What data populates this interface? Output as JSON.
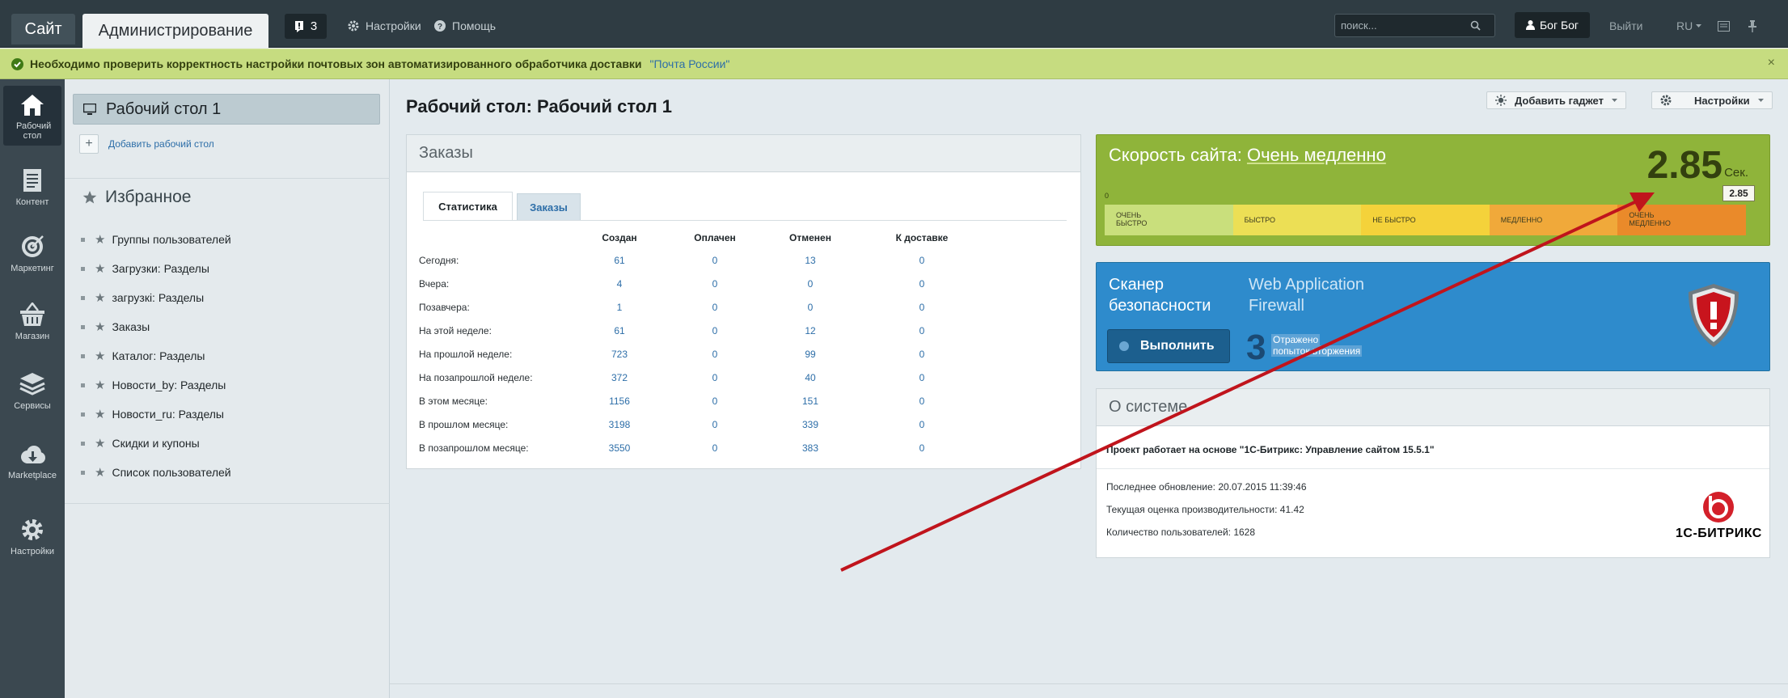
{
  "topbar": {
    "site_label": "Сайт",
    "admin_label": "Администрирование",
    "notif_count": "3",
    "settings_label": "Настройки",
    "help_label": "Помощь",
    "search_placeholder": "поиск...",
    "user_name": "Бог Бог",
    "logout_label": "Выйти",
    "lang_label": "RU"
  },
  "warning": {
    "text": "Необходимо проверить корректность настройки почтовых зон автоматизированного обработчика доставки",
    "link": "\"Почта России\"",
    "close": "×"
  },
  "leftmenu": [
    {
      "label": "Рабочий стол",
      "icon": "home-icon",
      "active": true
    },
    {
      "label": "Контент",
      "icon": "content-icon"
    },
    {
      "label": "Маркетинг",
      "icon": "target-icon"
    },
    {
      "label": "Магазин",
      "icon": "basket-icon"
    },
    {
      "label": "Сервисы",
      "icon": "layers-icon"
    },
    {
      "label": "Marketplace",
      "icon": "cloud-icon"
    },
    {
      "label": "Настройки",
      "icon": "gear-icon"
    }
  ],
  "sidebar": {
    "active_desktop": "Рабочий стол 1",
    "add_desktop": "Добавить рабочий стол",
    "favorites_title": "Избранное",
    "favorites": [
      "Группы пользователей",
      "Загрузки: Разделы",
      "загрузкі: Разделы",
      "Заказы",
      "Каталог: Разделы",
      "Новости_by: Разделы",
      "Новости_ru: Разделы",
      "Скидки и купоны",
      "Список пользователей"
    ]
  },
  "main": {
    "title": "Рабочий стол: Рабочий стол 1",
    "add_gadget": "Добавить гаджет",
    "settings": "Настройки"
  },
  "orders": {
    "title": "Заказы",
    "tabs": [
      "Статистика",
      "Заказы"
    ],
    "columns": [
      "Создан",
      "Оплачен",
      "Отменен",
      "К доставке"
    ],
    "rows": [
      {
        "label": "Сегодня:",
        "values": [
          "61",
          "0",
          "13",
          "0"
        ]
      },
      {
        "label": "Вчера:",
        "values": [
          "4",
          "0",
          "0",
          "0"
        ]
      },
      {
        "label": "Позавчера:",
        "values": [
          "1",
          "0",
          "0",
          "0"
        ]
      },
      {
        "label": "На этой неделе:",
        "values": [
          "61",
          "0",
          "12",
          "0"
        ]
      },
      {
        "label": "На прошлой неделе:",
        "values": [
          "723",
          "0",
          "99",
          "0"
        ]
      },
      {
        "label": "На позапрошлой неделе:",
        "values": [
          "372",
          "0",
          "40",
          "0"
        ]
      },
      {
        "label": "В этом месяце:",
        "values": [
          "1156",
          "0",
          "151",
          "0"
        ]
      },
      {
        "label": "В прошлом месяце:",
        "values": [
          "3198",
          "0",
          "339",
          "0"
        ]
      },
      {
        "label": "В позапрошлом месяце:",
        "values": [
          "3550",
          "0",
          "383",
          "0"
        ]
      }
    ]
  },
  "speed": {
    "title": "Скорость сайта:",
    "status": "Очень медленно",
    "value": "2.85",
    "unit": "Сек.",
    "marker": "2.85",
    "scale_start": "0",
    "segments": [
      {
        "label": "ОЧЕНЬ\nБЫСТРО",
        "color": "#c9df7c"
      },
      {
        "label": "БЫСТРО",
        "color": "#ecdf55"
      },
      {
        "label": "НЕ БЫСТРО",
        "color": "#f4d23a"
      },
      {
        "label": "МЕДЛЕННО",
        "color": "#f0a93a"
      },
      {
        "label": "ОЧЕНЬ\nМЕДЛЕННО",
        "color": "#ea8a2a"
      }
    ]
  },
  "scanner": {
    "title_line1": "Сканер",
    "title_line2": "безопасности",
    "waf_line1": "Web Application",
    "waf_line2": "Firewall",
    "button": "Выполнить",
    "count": "3",
    "count_line1": "Отражено",
    "count_line2": "попыток вторжения"
  },
  "system": {
    "title": "О системе",
    "project": "Проект работает на основе \"1С-Битрикс: Управление сайтом 15.5.1\"",
    "last_update": "Последнее обновление: 20.07.2015 11:39:46",
    "performance": "Текущая оценка производительности: 41.42",
    "users": "Количество пользователей: 1628",
    "logo_text": "1С-БИТРИКС"
  },
  "colors": {
    "topbar": "#2f3c43",
    "warning": "#c6dc80",
    "speed": "#8fb43a",
    "scanner": "#2e8bcc",
    "link": "#2d6ea8",
    "arrow": "#c0141c"
  }
}
